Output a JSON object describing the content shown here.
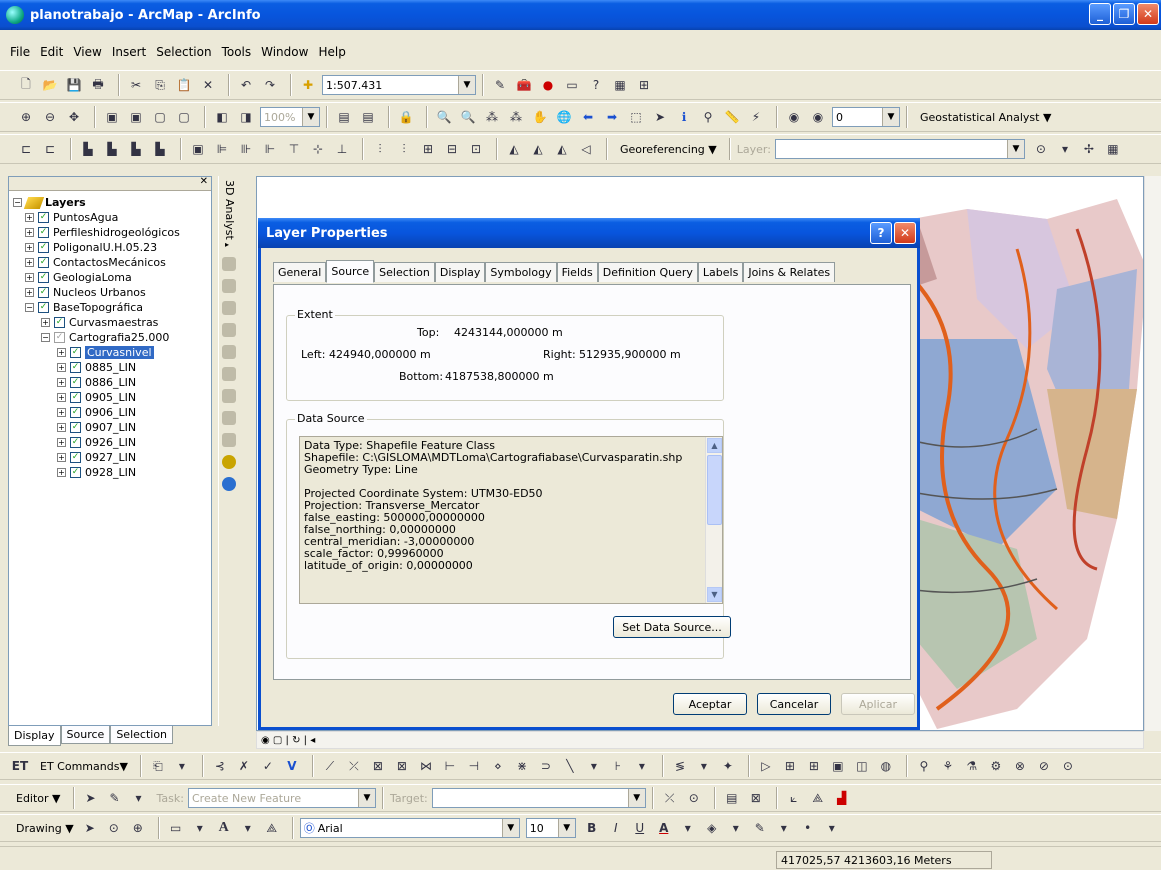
{
  "window": {
    "title": "planotrabajo - ArcMap - ArcInfo"
  },
  "menu": [
    "File",
    "Edit",
    "View",
    "Insert",
    "Selection",
    "Tools",
    "Window",
    "Help"
  ],
  "toolbar": {
    "scale": "1:507.431",
    "zoom_percent": "100%",
    "layer_index": "0",
    "geostatistical": "Geostatistical Analyst",
    "georeferencing": "Georeferencing",
    "layer_label": "Layer:"
  },
  "toc": {
    "root": "Layers",
    "items": [
      {
        "label": "PuntosAgua",
        "level": 1
      },
      {
        "label": "Perfileshidrogeológicos",
        "level": 1
      },
      {
        "label": "PoligonalU.H.05.23",
        "level": 1
      },
      {
        "label": "ContactosMecánicos",
        "level": 1
      },
      {
        "label": "GeologiaLoma",
        "level": 1
      },
      {
        "label": "Nucleos Urbanos",
        "level": 1
      },
      {
        "label": "BaseTopográfica",
        "level": 1
      },
      {
        "label": "Curvasmaestras",
        "level": 2
      },
      {
        "label": "Cartografia25.000",
        "level": 2
      },
      {
        "label": "Curvasnivel",
        "level": 3,
        "selected": true
      },
      {
        "label": "0885_LIN",
        "level": 3
      },
      {
        "label": "0886_LIN",
        "level": 3
      },
      {
        "label": "0905_LIN",
        "level": 3
      },
      {
        "label": "0906_LIN",
        "level": 3
      },
      {
        "label": "0907_LIN",
        "level": 3
      },
      {
        "label": "0926_LIN",
        "level": 3
      },
      {
        "label": "0927_LIN",
        "level": 3
      },
      {
        "label": "0928_LIN",
        "level": 3
      }
    ],
    "tabs": [
      "Display",
      "Source",
      "Selection"
    ],
    "vertical_toolbar": "3D Analyst"
  },
  "dialog": {
    "title": "Layer Properties",
    "tabs": [
      "General",
      "Source",
      "Selection",
      "Display",
      "Symbology",
      "Fields",
      "Definition Query",
      "Labels",
      "Joins & Relates"
    ],
    "active_tab": "Source",
    "extent": {
      "label": "Extent",
      "top_label": "Top:",
      "top": "4243144,000000 m",
      "left_label": "Left:",
      "left": "424940,000000 m",
      "right_label": "Right:",
      "right": "512935,900000 m",
      "bottom_label": "Bottom:",
      "bottom": "4187538,800000 m"
    },
    "data_source": {
      "label": "Data Source",
      "lines": [
        "Data Type: Shapefile Feature Class",
        "Shapefile: C:\\GISLOMA\\MDTLoma\\Cartografiabase\\Curvasparatin.shp",
        "Geometry Type: Line",
        "",
        "Projected Coordinate System: UTM30-ED50",
        "Projection: Transverse_Mercator",
        "false_easting: 500000,00000000",
        "false_northing: 0,00000000",
        "central_meridian: -3,00000000",
        "scale_factor: 0,99960000",
        "latitude_of_origin: 0,00000000"
      ],
      "set_button": "Set Data Source..."
    },
    "buttons": {
      "ok": "Aceptar",
      "cancel": "Cancelar",
      "apply": "Aplicar"
    }
  },
  "bottom": {
    "et_commands": "ET Commands",
    "editor": "Editor",
    "task_label": "Task:",
    "task_value": "Create New Feature",
    "target_label": "Target:",
    "drawing": "Drawing",
    "font": "Arial",
    "font_size": "10",
    "bold": "B",
    "italic": "I",
    "underline": "U",
    "font_color": "A"
  },
  "status": {
    "coordinates": "417025,57 4213603,16 Meters"
  }
}
